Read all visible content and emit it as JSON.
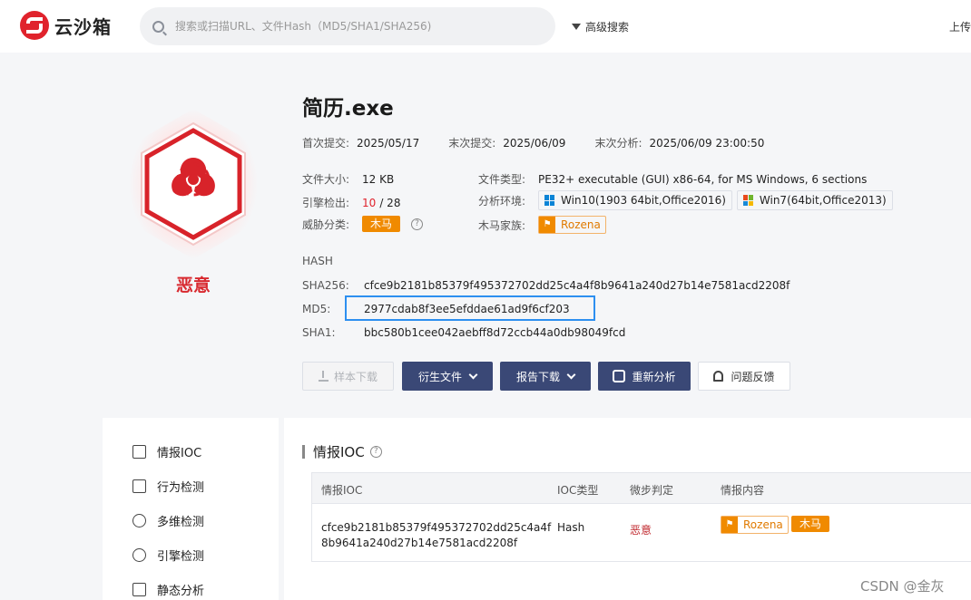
{
  "header": {
    "logo_text": "云沙箱",
    "search_placeholder": "搜索或扫描URL、文件Hash（MD5/SHA1/SHA256)",
    "advanced_search": "高级搜索",
    "upload": "上传"
  },
  "verdict": {
    "label": "恶意",
    "color": "#d8292f"
  },
  "file": {
    "name": "简历.exe",
    "first_submit_label": "首次提交:",
    "first_submit": "2025/05/17",
    "last_submit_label": "末次提交:",
    "last_submit": "2025/06/09",
    "last_analysis_label": "末次分析:",
    "last_analysis": "2025/06/09 23:00:50",
    "size_label": "文件大小:",
    "size": "12 KB",
    "type_label": "文件类型:",
    "type": "PE32+ executable (GUI) x86-64, for MS Windows, 6 sections",
    "engine_label": "引擎检出:",
    "engine_detected": "10",
    "engine_total": "/ 28",
    "env_label": "分析环境:",
    "env_win10": "Win10(1903 64bit,Office2016)",
    "env_win7": "Win7(64bit,Office2013)",
    "threat_label": "威胁分类:",
    "threat": "木马",
    "family_label": "木马家族:",
    "family": "Rozena",
    "help_glyph": "?"
  },
  "hash": {
    "section": "HASH",
    "sha256_label": "SHA256:",
    "sha256": "cfce9b2181b85379f495372702dd25c4a4f8b9641a240d27b14e7581acd2208f",
    "md5_label": "MD5:",
    "md5": "2977cdab8f3ee5efddae61ad9f6cf203",
    "sha1_label": "SHA1:",
    "sha1": "bbc580b1cee042aebff8d72ccb44a0db98049fcd"
  },
  "actions": {
    "sample_download": "样本下载",
    "derived_files": "衍生文件",
    "report_download": "报告下载",
    "reanalyze": "重新分析",
    "feedback": "问题反馈"
  },
  "sidebar": {
    "items": [
      {
        "label": "情报IOC",
        "icon": "checklist-icon"
      },
      {
        "label": "行为检测",
        "icon": "chart-icon"
      },
      {
        "label": "多维检测",
        "icon": "radar-icon"
      },
      {
        "label": "引擎检测",
        "icon": "question-circle-icon"
      },
      {
        "label": "静态分析",
        "icon": "document-icon"
      }
    ]
  },
  "ioc": {
    "title": "情报IOC",
    "columns": [
      "情报IOC",
      "IOC类型",
      "微步判定",
      "情报内容"
    ],
    "rows": [
      {
        "ioc_line1": "cfce9b2181b85379f495372702dd25c4a4f",
        "ioc_line2": "8b9641a240d27b14e7581acd2208f",
        "type": "Hash",
        "verdict": "恶意",
        "family_tag": "Rozena",
        "threat_tag": "木马"
      }
    ]
  },
  "watermark": "CSDN @金灰",
  "colors": {
    "accent_red": "#e0232c",
    "button_dark": "#3a4876",
    "tag_orange": "#f08a00",
    "highlight_blue": "#2d8ff0"
  }
}
